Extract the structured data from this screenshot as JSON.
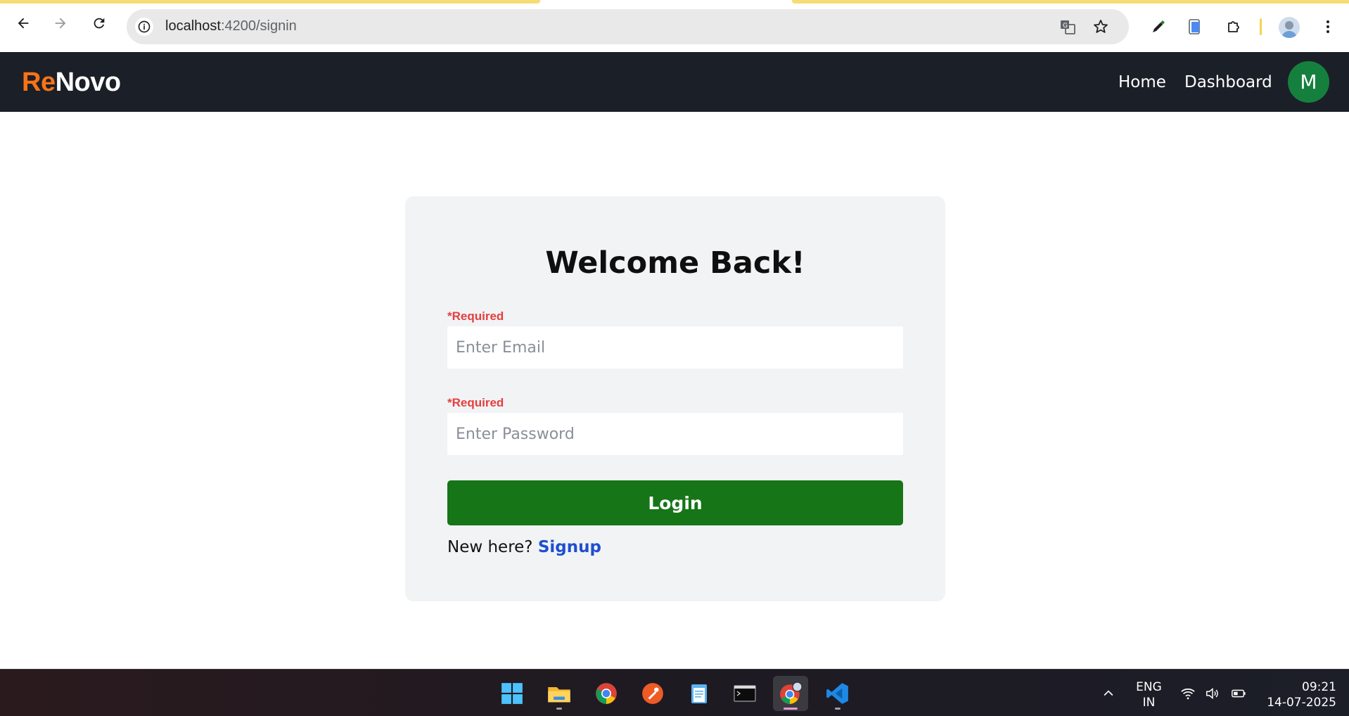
{
  "browser": {
    "url_host": "localhost",
    "url_path": ":4200/signin"
  },
  "navbar": {
    "logo_part1": "Re",
    "logo_part2": "Novo",
    "links": [
      {
        "label": "Home"
      },
      {
        "label": "Dashboard"
      }
    ],
    "avatar_initial": "M"
  },
  "login": {
    "title": "Welcome Back!",
    "email_required": "*Required",
    "email_placeholder": "Enter Email",
    "password_required": "*Required",
    "password_placeholder": "Enter Password",
    "button_label": "Login",
    "signup_prompt": "New here?",
    "signup_link": "Signup"
  },
  "taskbar": {
    "apps": [
      "windows-start",
      "file-explorer",
      "chrome",
      "postman",
      "notepad",
      "terminal",
      "chrome-profile",
      "vscode"
    ],
    "language_line1": "ENG",
    "language_line2": "IN",
    "time": "09:21",
    "date": "14-07-2025"
  },
  "colors": {
    "navbar_bg": "#1b1f28",
    "logo_accent": "#f97316",
    "login_button": "#157517",
    "required_text": "#e53e3e",
    "signup_link": "#1d4fd0",
    "avatar_bg": "#15803d"
  }
}
